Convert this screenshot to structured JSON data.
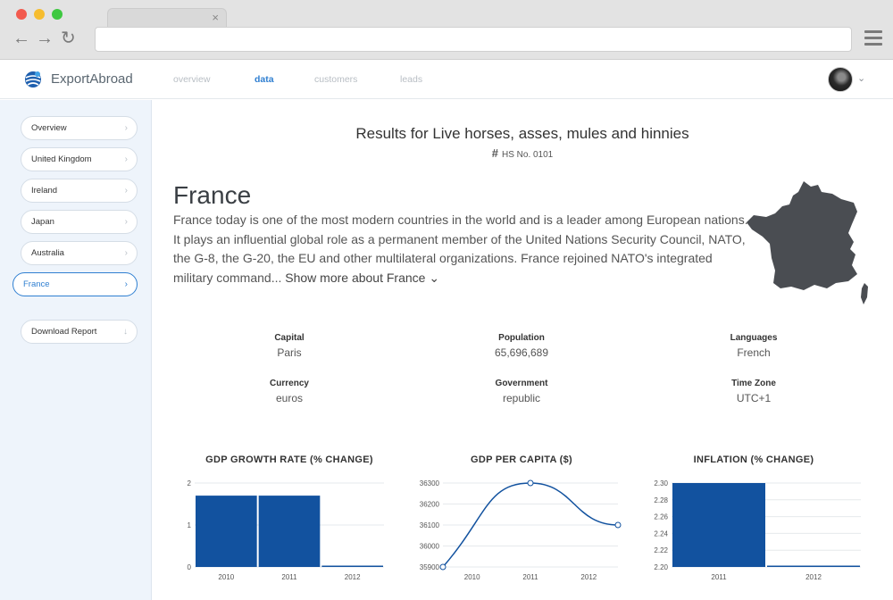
{
  "browser": {
    "tab_close": "×",
    "back": "←",
    "forward": "→",
    "reload": "↻"
  },
  "header": {
    "brand": "ExportAbroad",
    "nav": [
      "overview",
      "data",
      "customers",
      "leads"
    ],
    "active_nav": "data",
    "avatar_chevron": "⌄",
    "accent": "#2f7fd1"
  },
  "sidebar": {
    "items": [
      {
        "label": "Overview",
        "icon": "chevron-right-icon"
      },
      {
        "label": "United Kingdom",
        "icon": "chevron-right-icon"
      },
      {
        "label": "Ireland",
        "icon": "chevron-right-icon"
      },
      {
        "label": "Japan",
        "icon": "chevron-right-icon"
      },
      {
        "label": "Australia",
        "icon": "chevron-right-icon"
      },
      {
        "label": "France",
        "icon": "chevron-right-icon",
        "active": true
      }
    ],
    "download_label": "Download Report",
    "chev": "›",
    "download_icon": "↓"
  },
  "main": {
    "results_title": "Results for Live horses, asses, mules and hinnies",
    "hs_symbol": "#",
    "hs_code": "HS No. 0101",
    "country": "France",
    "description": "France today is one of the most modern countries in the world and is a leader among European nations. It plays an influential global role as a permanent member of the United Nations Security Council, NATO, the G-8, the G-20, the EU and other multilateral organizations. France rejoined NATO's integrated military command... ",
    "show_more": "Show more about France",
    "show_more_icon": "⌄",
    "map_color": "#4a4d52",
    "facts": [
      {
        "label": "Capital",
        "value": "Paris"
      },
      {
        "label": "Population",
        "value": "65,696,689"
      },
      {
        "label": "Languages",
        "value": "French"
      },
      {
        "label": "Currency",
        "value": "euros"
      },
      {
        "label": "Government",
        "value": "republic"
      },
      {
        "label": "Time Zone",
        "value": "UTC+1"
      }
    ]
  },
  "chart_data": [
    {
      "type": "bar",
      "title": "GDP GROWTH RATE (% CHANGE)",
      "categories": [
        "2010",
        "2011",
        "2012"
      ],
      "values": [
        1.7,
        1.7,
        0.0
      ],
      "ylim": [
        0,
        2
      ],
      "yticks": [
        "0",
        "1",
        "2"
      ],
      "color": "#12529f",
      "grid": true
    },
    {
      "type": "line",
      "title": "GDP PER CAPITA ($)",
      "x": [
        "2010",
        "2011",
        "2012"
      ],
      "values": [
        35900,
        36300,
        36100
      ],
      "ylim": [
        35900,
        36300
      ],
      "yticks": [
        "35900",
        "36000",
        "36100",
        "36200",
        "36300"
      ],
      "color": "#12529f",
      "grid": true
    },
    {
      "type": "bar",
      "title": "INFLATION (% CHANGE)",
      "categories": [
        "2011",
        "2012"
      ],
      "values": [
        2.3,
        2.2
      ],
      "ylim": [
        2.2,
        2.3
      ],
      "yticks": [
        "2.20",
        "2.22",
        "2.24",
        "2.26",
        "2.28",
        "2.30"
      ],
      "color": "#12529f",
      "grid": true
    }
  ]
}
